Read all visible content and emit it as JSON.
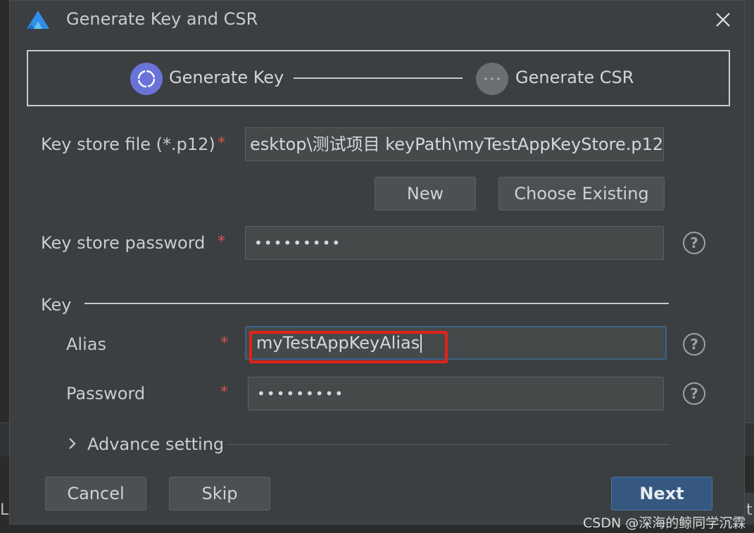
{
  "dialog": {
    "title": "Generate Key and CSR",
    "close_icon": "close-icon",
    "logo_icon": "devstudio-logo-icon"
  },
  "stepper": {
    "step1": "Generate Key",
    "step2": "Generate CSR"
  },
  "keystore": {
    "file_label": "Key store file (*.p12)",
    "file_value": "esktop\\测试项目 keyPath\\myTestAppKeyStore.p12",
    "new_button": "New",
    "choose_button": "Choose Existing",
    "password_label": "Key store password",
    "password_value": "•••••••••"
  },
  "key": {
    "section_label": "Key",
    "alias_label": "Alias",
    "alias_value": "myTestAppKeyAlias",
    "password_label": "Password",
    "password_value": "•••••••••",
    "advance_label": "Advance setting"
  },
  "required_mark": "*",
  "help_mark": "?",
  "footer": {
    "cancel": "Cancel",
    "skip": "Skip",
    "next": "Next"
  },
  "watermark": "CSDN @深海的鲸同学沉霖",
  "colors": {
    "accent": "#365880",
    "step_active": "#6a74d8",
    "highlight": "#e2231a",
    "required": "#d9534f"
  }
}
